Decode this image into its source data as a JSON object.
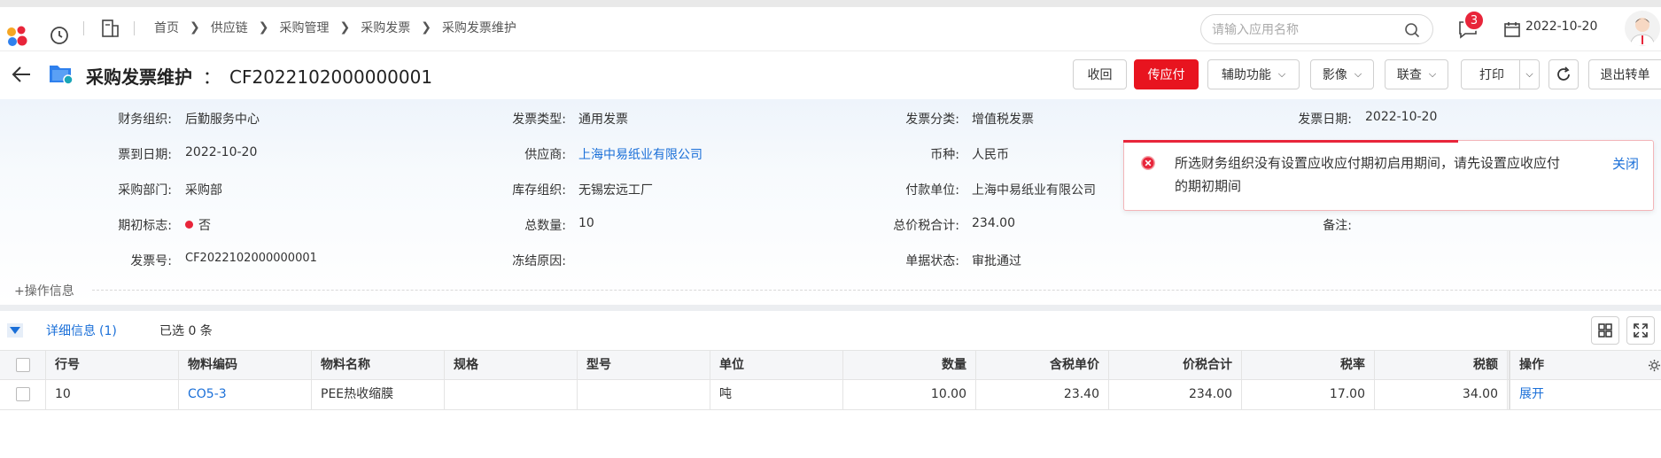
{
  "topbar": {
    "breadcrumbs": [
      "首页",
      "供应链",
      "采购管理",
      "采购发票",
      "采购发票维护"
    ],
    "search_placeholder": "请输入应用名称",
    "message_count": "3",
    "date": "2022-10-20"
  },
  "titlebar": {
    "title": "采购发票维护",
    "separator": "：",
    "code": "CF2022102000000001",
    "buttons": {
      "recall": "收回",
      "transfer_ap": "传应付",
      "aux": "辅助功能",
      "image": "影像",
      "link_query": "联查",
      "print": "打印",
      "exit": "退出转单"
    }
  },
  "form": {
    "finance_org_label": "财务组织:",
    "finance_org": "后勤服务中心",
    "invoice_type_label": "发票类型:",
    "invoice_type": "通用发票",
    "invoice_category_label": "发票分类:",
    "invoice_category": "增值税发票",
    "invoice_date_label": "发票日期:",
    "invoice_date": "2022-10-20",
    "arrival_date_label": "票到日期:",
    "arrival_date": "2022-10-20",
    "supplier_label": "供应商:",
    "supplier": "上海中易纸业有限公司",
    "currency_label": "币种:",
    "currency": "人民币",
    "purchase_dept_label": "采购部门:",
    "purchase_dept": "采购部",
    "stock_org_label": "库存组织:",
    "stock_org": "无锡宏远工厂",
    "payee_label": "付款单位:",
    "payee": "上海中易纸业有限公司",
    "initial_flag_label": "期初标志:",
    "initial_flag": "否",
    "total_qty_label": "总数量:",
    "total_qty": "10",
    "total_amount_label": "总价税合计:",
    "total_amount": "234.00",
    "remark_label": "备注:",
    "invoice_no_label": "发票号:",
    "invoice_no": "CF2022102000000001",
    "freeze_reason_label": "冻结原因:",
    "doc_status_label": "单据状态:",
    "doc_status": "审批通过",
    "op_info": "+操作信息"
  },
  "toast": {
    "message": "所选财务组织没有设置应收应付期初启用期间，请先设置应收应付的期初期间",
    "close": "关闭"
  },
  "detail": {
    "tab_label": "详细信息",
    "tab_count": "(1)",
    "selected": "已选 0 条",
    "columns": [
      "行号",
      "物料编码",
      "物料名称",
      "规格",
      "型号",
      "单位",
      "数量",
      "含税单价",
      "价税合计",
      "税率",
      "税额",
      "操作"
    ],
    "rows": [
      [
        "10",
        "CO5-3",
        "PEE热收缩膜",
        "",
        "",
        "吨",
        "10.00",
        "23.40",
        "234.00",
        "17.00",
        "34.00",
        "展开"
      ]
    ]
  },
  "colors": {
    "primary_red": "#e8141f",
    "link_blue": "#1a6fd8",
    "badge_red": "#e8253a"
  }
}
